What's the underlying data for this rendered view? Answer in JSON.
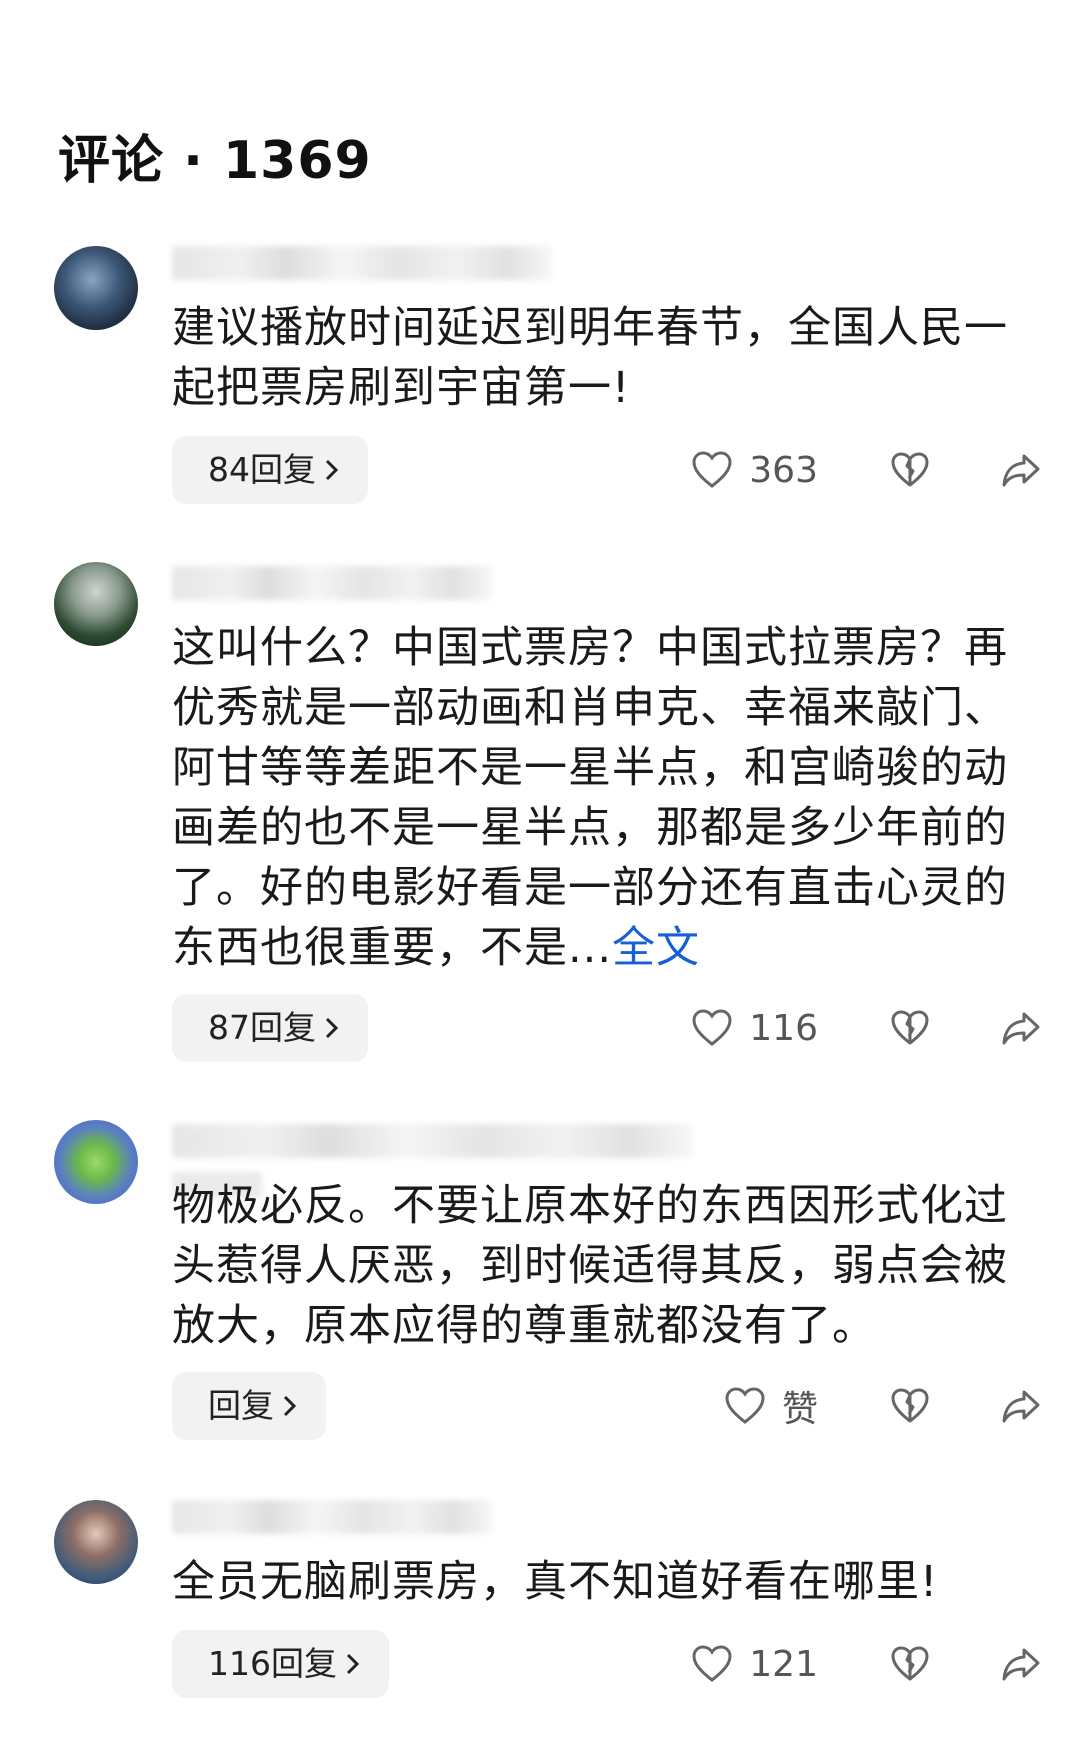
{
  "header": {
    "title": "评论 · 1369"
  },
  "comments": [
    {
      "text": "建议播放时间延迟到明年春节，全国人民一起把票房刷到宇宙第一!",
      "more": "",
      "reply_label": "84回复",
      "likes": "363"
    },
    {
      "text": "这叫什么？中国式票房？中国式拉票房？再优秀就是一部动画和肖申克、幸福来敲门、阿甘等等差距不是一星半点，和宫崎骏的动画差的也不是一星半点，那都是多少年前的了。好的电影好看是一部分还有直击心灵的东西也很重要，不是...",
      "more": "全文",
      "reply_label": "87回复",
      "likes": "116"
    },
    {
      "text": "物极必反。不要让原本好的东西因形式化过头惹得人厌恶，到时候适得其反，弱点会被放大，原本应得的尊重就都没有了。",
      "more": "",
      "reply_label": "回复",
      "likes": "赞"
    },
    {
      "text": "全员无脑刷票房，真不知道好看在哪里!",
      "more": "",
      "reply_label": "116回复",
      "likes": "121"
    }
  ],
  "icons": {
    "like": "heart-outline-icon",
    "dislike": "broken-heart-icon",
    "share": "share-arrow-icon",
    "chevron": "chevron-right-icon"
  },
  "colors": {
    "link": "#1560d4",
    "reply_bg": "#f2f2f2",
    "text": "#1a1a1a"
  }
}
